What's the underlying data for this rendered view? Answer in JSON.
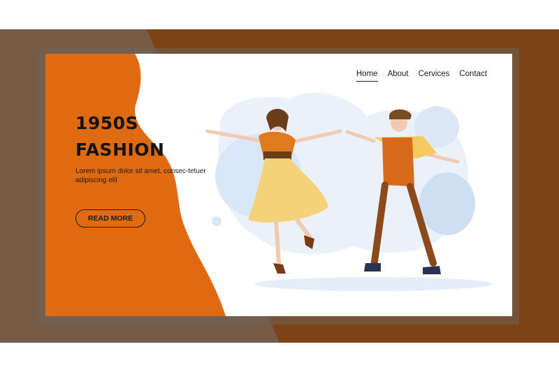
{
  "nav": {
    "items": [
      {
        "label": "Home",
        "active": true
      },
      {
        "label": "About",
        "active": false
      },
      {
        "label": "Cervices",
        "active": false
      },
      {
        "label": "Contact",
        "active": false
      }
    ]
  },
  "hero": {
    "title_line1": "1950S",
    "title_line2": "FASHION",
    "description": "Lorem ipsum dolor sit amet, consec-tetuer adipiscing elit",
    "cta_label": "READ MORE"
  },
  "colors": {
    "frame_dark": "#7a5a42",
    "frame_brown": "#7b4317",
    "accent_orange": "#e06a10",
    "text": "#141414"
  }
}
